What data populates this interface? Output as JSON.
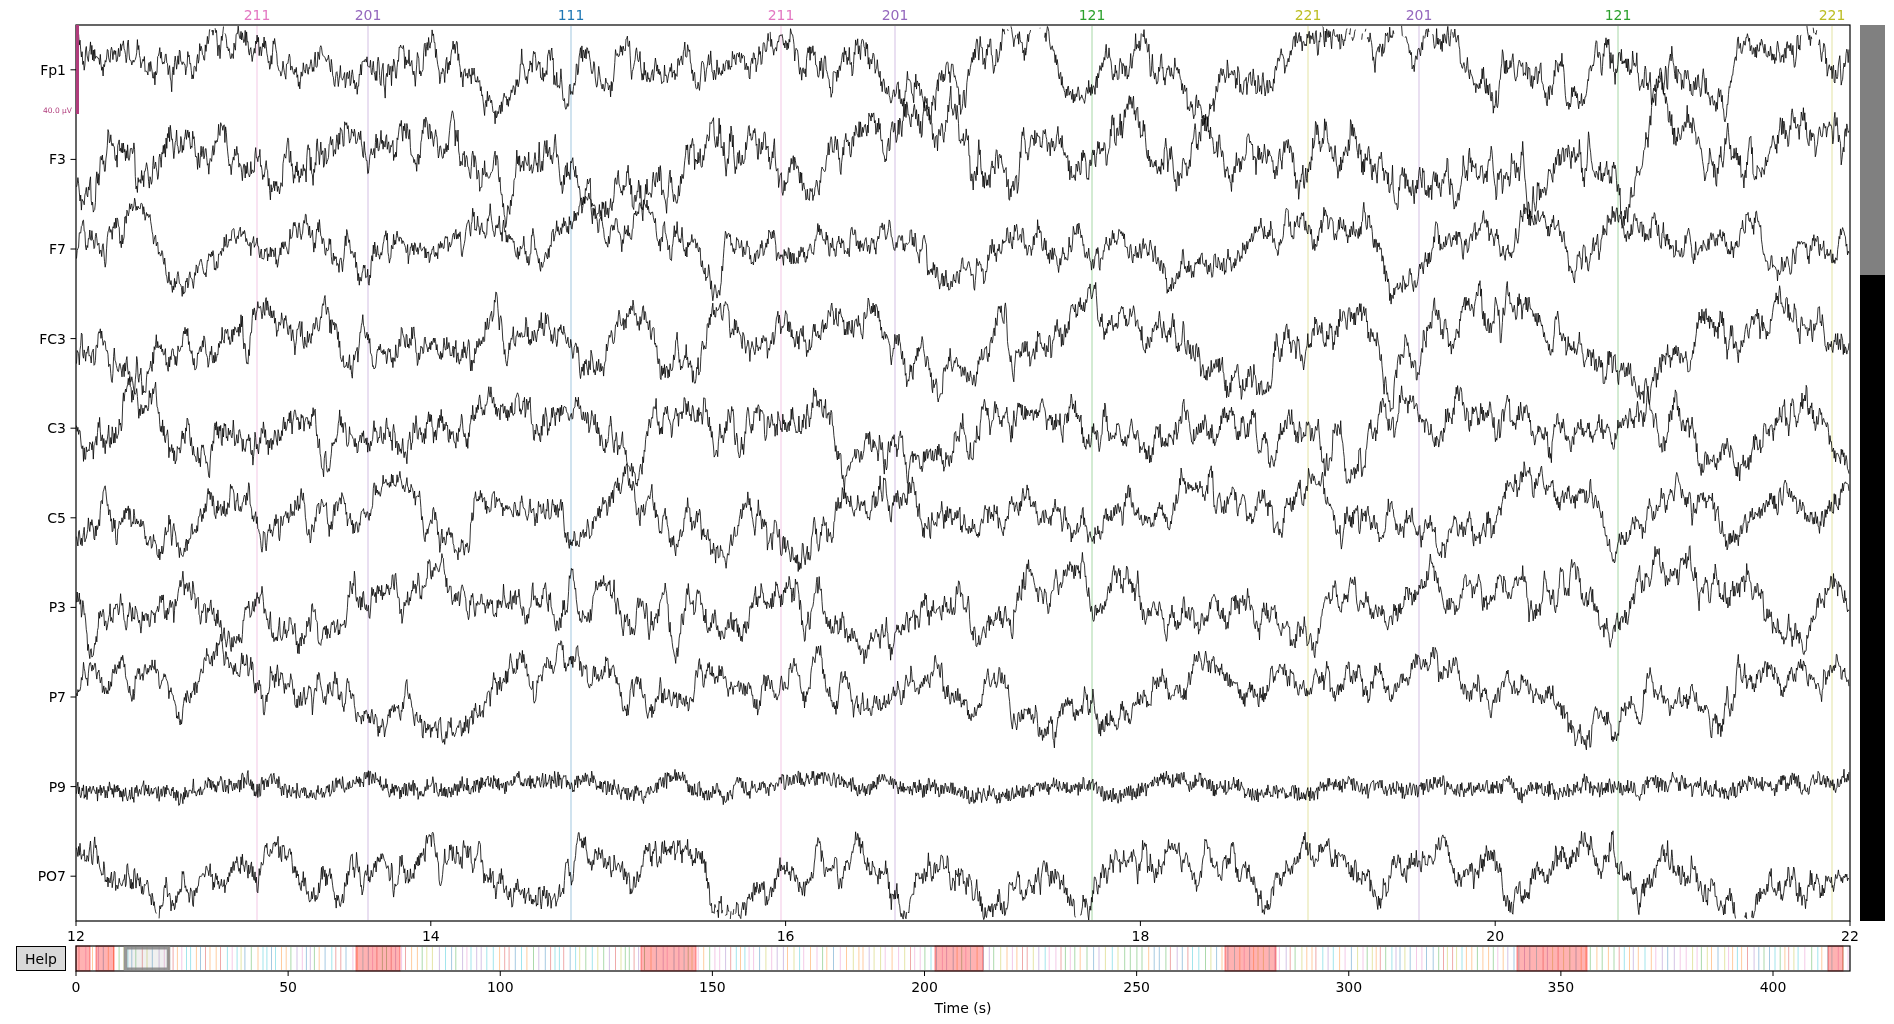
{
  "annotations": [
    {
      "label": "211",
      "color": "#e377c2"
    },
    {
      "label": "201",
      "color": "#9467bd"
    },
    {
      "label": "111",
      "color": "#1f77b4"
    },
    {
      "label": "211",
      "color": "#e377c2"
    },
    {
      "label": "201",
      "color": "#9467bd"
    },
    {
      "label": "121",
      "color": "#2ca02c"
    },
    {
      "label": "221",
      "color": "#bcbd22"
    },
    {
      "label": "201",
      "color": "#9467bd"
    },
    {
      "label": "121",
      "color": "#2ca02c"
    },
    {
      "label": "221",
      "color": "#bcbd22"
    }
  ],
  "scale_bar": {
    "label": "40.0 µV"
  },
  "channels": [
    "Fp1",
    "F3",
    "F7",
    "FC3",
    "C3",
    "C5",
    "P3",
    "P7",
    "P9",
    "PO7"
  ],
  "time_axis": {
    "ticks": [
      "12",
      "14",
      "16",
      "18",
      "20",
      "22"
    ]
  },
  "help_button": {
    "label": "Help"
  },
  "overview": {
    "ticks": [
      "0",
      "50",
      "100",
      "150",
      "200",
      "250",
      "300",
      "350",
      "400"
    ],
    "xlabel": "Time (s)"
  }
}
